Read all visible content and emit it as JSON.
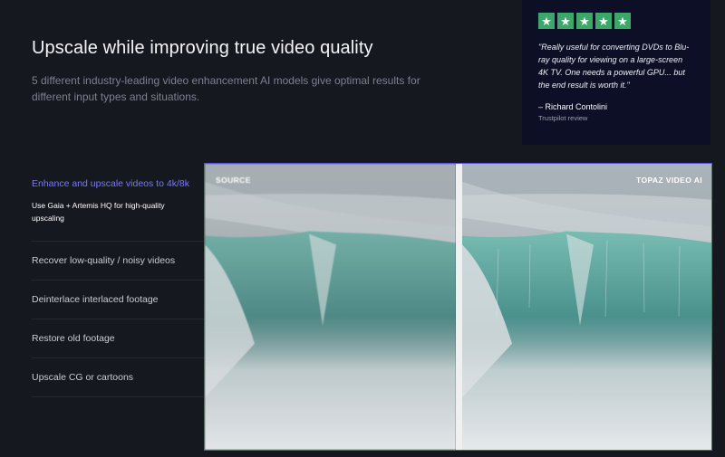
{
  "hero": {
    "title": "Upscale while improving true video quality",
    "subtitle": "5 different industry-leading video enhancement AI models give optimal results for different input types and situations."
  },
  "review": {
    "rating": 5,
    "star_color": "#3fa66a",
    "quote": "\"Really useful for converting DVDs to Blu-ray quality for viewing on a large-screen 4K TV. One needs a powerful GPU... but the end result is worth it.\"",
    "author": "– Richard Contolini",
    "source": "Trustpilot review"
  },
  "features": {
    "active": {
      "title": "Enhance and upscale videos to 4k/8k",
      "description": "Use Gaia + Artemis HQ for high-quality upscaling"
    },
    "items": [
      {
        "label": "Recover low-quality / noisy videos"
      },
      {
        "label": "Deinterlace interlaced footage"
      },
      {
        "label": "Restore old footage"
      },
      {
        "label": "Upscale CG or cartoons"
      }
    ]
  },
  "comparison": {
    "left_label": "SOURCE",
    "right_label": "TOPAZ VIDEO AI",
    "accent_color": "#5659d8"
  }
}
